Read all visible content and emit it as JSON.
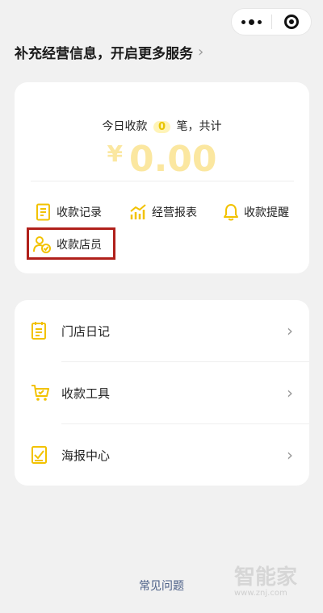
{
  "banner": {
    "text": "补充经营信息，开启更多服务",
    "chevron": "›"
  },
  "summary": {
    "prefix": "今日收款",
    "count": "0",
    "suffix": "笔，共计",
    "currency": "¥",
    "amount": "0.00"
  },
  "quick_actions": [
    {
      "label": "收款记录",
      "icon": "document-icon"
    },
    {
      "label": "经营报表",
      "icon": "bar-chart-icon"
    },
    {
      "label": "收款提醒",
      "icon": "bell-icon"
    },
    {
      "label": "收款店员",
      "icon": "staff-icon"
    }
  ],
  "menu": [
    {
      "label": "门店日记",
      "icon": "notepad-icon"
    },
    {
      "label": "收款工具",
      "icon": "cart-icon"
    },
    {
      "label": "海报中心",
      "icon": "poster-icon"
    }
  ],
  "footer": {
    "faq": "常见问题"
  },
  "watermark": {
    "title": "智能家",
    "url": "www.znj.com"
  },
  "colors": {
    "accent": "#f2c200",
    "highlight_border": "#b0201b",
    "amount": "#fbe7a0",
    "link": "#4a5e86"
  }
}
